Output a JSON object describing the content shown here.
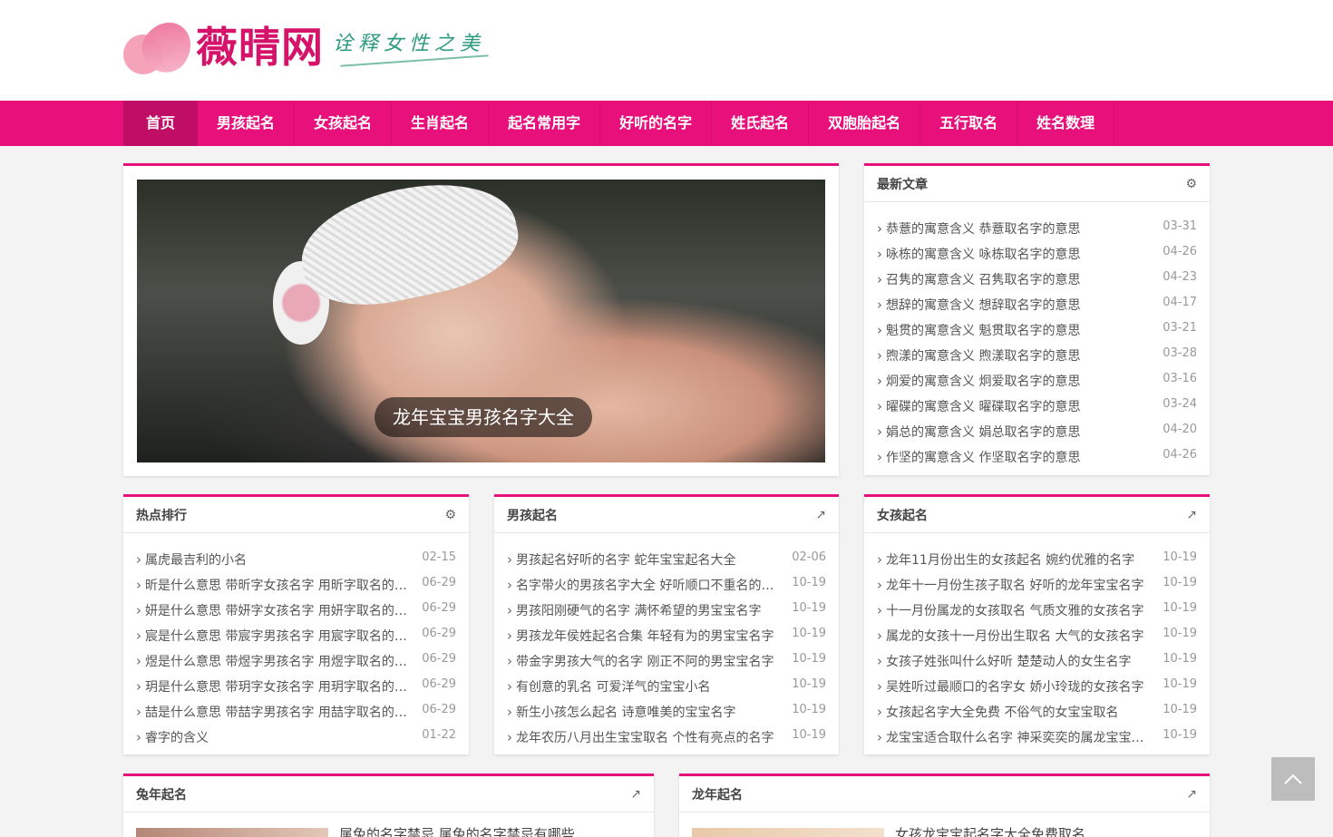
{
  "logo": {
    "name": "薇晴网",
    "slogan": "诠释女性之美"
  },
  "nav": [
    "首页",
    "男孩起名",
    "女孩起名",
    "生肖起名",
    "起名常用字",
    "好听的名字",
    "姓氏起名",
    "双胞胎起名",
    "五行取名",
    "姓名数理"
  ],
  "hero": {
    "caption": "龙年宝宝男孩名字大全"
  },
  "latest": {
    "title": "最新文章",
    "items": [
      {
        "t": "恭薏的寓意含义 恭薏取名字的意思",
        "d": "03-31"
      },
      {
        "t": "咏栋的寓意含义 咏栋取名字的意思",
        "d": "04-26"
      },
      {
        "t": "召隽的寓意含义 召隽取名字的意思",
        "d": "04-23"
      },
      {
        "t": "想辞的寓意含义 想辞取名字的意思",
        "d": "04-17"
      },
      {
        "t": "魁贯的寓意含义 魁贯取名字的意思",
        "d": "03-21"
      },
      {
        "t": "煦漾的寓意含义 煦漾取名字的意思",
        "d": "03-28"
      },
      {
        "t": "炯爱的寓意含义 炯爱取名字的意思",
        "d": "03-16"
      },
      {
        "t": "曜碟的寓意含义 曜碟取名字的意思",
        "d": "03-24"
      },
      {
        "t": "娟总的寓意含义 娟总取名字的意思",
        "d": "04-20"
      },
      {
        "t": "作坚的寓意含义 作坚取名字的意思",
        "d": "04-26"
      }
    ]
  },
  "hot": {
    "title": "热点排行",
    "items": [
      {
        "t": "属虎最吉利的小名",
        "d": "02-15"
      },
      {
        "t": "昕是什么意思 带昕字女孩名字 用昕字取名的寓意",
        "d": "06-29"
      },
      {
        "t": "妍是什么意思 带妍字女孩名字 用妍字取名的寓意",
        "d": "06-29"
      },
      {
        "t": "宸是什么意思 带宸字男孩名字 用宸字取名的寓意",
        "d": "06-29"
      },
      {
        "t": "煜是什么意思 带煜字男孩名字 用煜字取名的寓意",
        "d": "06-29"
      },
      {
        "t": "玥是什么意思 带玥字女孩名字 用玥字取名的寓意",
        "d": "06-29"
      },
      {
        "t": "喆是什么意思 带喆字男孩名字 用喆字取名的寓意",
        "d": "06-29"
      },
      {
        "t": "睿字的含义",
        "d": "01-22"
      }
    ]
  },
  "boys": {
    "title": "男孩起名",
    "items": [
      {
        "t": "男孩起名好听的名字 蛇年宝宝起名大全",
        "d": "02-06"
      },
      {
        "t": "名字带火的男孩名字大全 好听顺口不重名的名字",
        "d": "10-19"
      },
      {
        "t": "男孩阳刚硬气的名字 满怀希望的男宝宝名字",
        "d": "10-19"
      },
      {
        "t": "男孩龙年侯姓起名合集 年轻有为的男宝宝名字",
        "d": "10-19"
      },
      {
        "t": "带金字男孩大气的名字 刚正不阿的男宝宝名字",
        "d": "10-19"
      },
      {
        "t": "有创意的乳名 可爱洋气的宝宝小名",
        "d": "10-19"
      },
      {
        "t": "新生小孩怎么起名 诗意唯美的宝宝名字",
        "d": "10-19"
      },
      {
        "t": "龙年农历八月出生宝宝取名 个性有亮点的名字",
        "d": "10-19"
      }
    ]
  },
  "girls": {
    "title": "女孩起名",
    "items": [
      {
        "t": "龙年11月份出生的女孩起名 婉约优雅的名字",
        "d": "10-19"
      },
      {
        "t": "龙年十一月份生孩子取名 好听的龙年宝宝名字",
        "d": "10-19"
      },
      {
        "t": "十一月份属龙的女孩取名 气质文雅的女孩名字",
        "d": "10-19"
      },
      {
        "t": "属龙的女孩十一月份出生取名 大气的女孩名字",
        "d": "10-19"
      },
      {
        "t": "女孩子姓张叫什么好听 楚楚动人的女生名字",
        "d": "10-19"
      },
      {
        "t": "吴姓听过最顺口的名字女 娇小玲珑的女孩名字",
        "d": "10-19"
      },
      {
        "t": "女孩起名字大全免费 不俗气的女宝宝取名",
        "d": "10-19"
      },
      {
        "t": "龙宝宝适合取什么名字 神采奕奕的属龙宝宝名字",
        "d": "10-19"
      }
    ]
  },
  "rabbit": {
    "title": "兔年起名",
    "first": "属兔的名字禁忌 属兔的名字禁忌有哪些"
  },
  "dragon": {
    "title": "龙年起名",
    "first": "女孩龙宝宝起名字大全免费取名"
  }
}
